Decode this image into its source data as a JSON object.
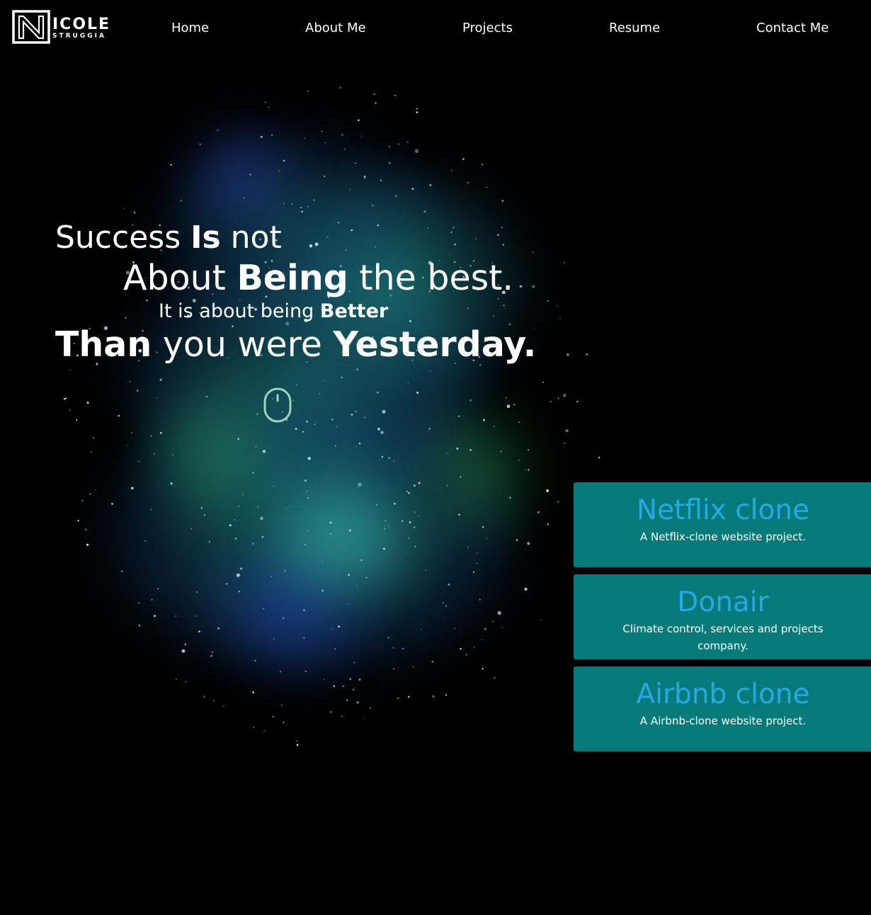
{
  "logo": {
    "first": "ICOLE",
    "last": "STRUGGIA",
    "icon": "n-monogram-icon"
  },
  "nav": {
    "items": [
      {
        "label": "Home"
      },
      {
        "label": "About Me"
      },
      {
        "label": "Projects"
      },
      {
        "label": "Resume"
      },
      {
        "label": "Contact Me"
      }
    ]
  },
  "hero": {
    "line1": {
      "a": "Success ",
      "b": "Is",
      "c": " not"
    },
    "line2": {
      "a": "About ",
      "b": "Being",
      "c": " the best."
    },
    "line3": {
      "a": "It is about being ",
      "b": "Better"
    },
    "line4": {
      "a": "Than",
      "b": " you were ",
      "c": "Yesterday."
    },
    "scroll_icon": "mouse-scroll-icon"
  },
  "projects": [
    {
      "title": "Netflix clone",
      "description": "A Netflix-clone website project."
    },
    {
      "title": "Donair",
      "description": "Climate control, services and projects company."
    },
    {
      "title": "Airbnb clone",
      "description": "A Airbnb-clone website project."
    }
  ],
  "colors": {
    "background": "#000000",
    "card": "#057a79",
    "card_title": "#27a8e6",
    "text": "#ffffff",
    "nebula_teal": "#1fb3a3",
    "nebula_blue": "#1e4fa0"
  }
}
